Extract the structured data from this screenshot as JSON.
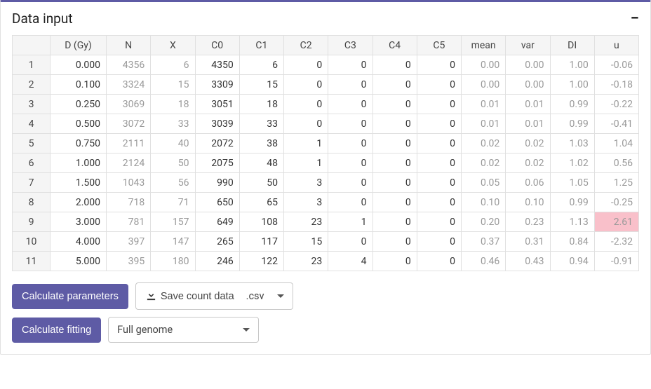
{
  "panel": {
    "title": "Data input",
    "collapse_glyph": "−"
  },
  "table": {
    "headers": [
      "",
      "D (Gy)",
      "N",
      "X",
      "C0",
      "C1",
      "C2",
      "C3",
      "C4",
      "C5",
      "mean",
      "var",
      "DI",
      "u"
    ],
    "grey_cols": [
      2,
      3,
      10,
      11,
      12,
      13
    ],
    "highlight": {
      "row": 8,
      "col": 13
    },
    "rows": [
      [
        "1",
        "0.000",
        "4356",
        "6",
        "4350",
        "6",
        "0",
        "0",
        "0",
        "0",
        "0.00",
        "0.00",
        "1.00",
        "-0.06"
      ],
      [
        "2",
        "0.100",
        "3324",
        "15",
        "3309",
        "15",
        "0",
        "0",
        "0",
        "0",
        "0.00",
        "0.00",
        "1.00",
        "-0.18"
      ],
      [
        "3",
        "0.250",
        "3069",
        "18",
        "3051",
        "18",
        "0",
        "0",
        "0",
        "0",
        "0.01",
        "0.01",
        "0.99",
        "-0.22"
      ],
      [
        "4",
        "0.500",
        "3072",
        "33",
        "3039",
        "33",
        "0",
        "0",
        "0",
        "0",
        "0.01",
        "0.01",
        "0.99",
        "-0.41"
      ],
      [
        "5",
        "0.750",
        "2111",
        "40",
        "2072",
        "38",
        "1",
        "0",
        "0",
        "0",
        "0.02",
        "0.02",
        "1.03",
        "1.04"
      ],
      [
        "6",
        "1.000",
        "2124",
        "50",
        "2075",
        "48",
        "1",
        "0",
        "0",
        "0",
        "0.02",
        "0.02",
        "1.02",
        "0.56"
      ],
      [
        "7",
        "1.500",
        "1043",
        "56",
        "990",
        "50",
        "3",
        "0",
        "0",
        "0",
        "0.05",
        "0.06",
        "1.05",
        "1.25"
      ],
      [
        "8",
        "2.000",
        "718",
        "71",
        "650",
        "65",
        "3",
        "0",
        "0",
        "0",
        "0.10",
        "0.10",
        "0.99",
        "-0.25"
      ],
      [
        "9",
        "3.000",
        "781",
        "157",
        "649",
        "108",
        "23",
        "1",
        "0",
        "0",
        "0.20",
        "0.23",
        "1.13",
        "2.61"
      ],
      [
        "10",
        "4.000",
        "397",
        "147",
        "265",
        "117",
        "15",
        "0",
        "0",
        "0",
        "0.37",
        "0.31",
        "0.84",
        "-2.32"
      ],
      [
        "11",
        "5.000",
        "395",
        "180",
        "246",
        "122",
        "23",
        "4",
        "0",
        "0",
        "0.46",
        "0.43",
        "0.94",
        "-0.91"
      ]
    ]
  },
  "buttons": {
    "calc_params": "Calculate parameters",
    "save_count": "Save count data",
    "calc_fitting": "Calculate fitting"
  },
  "selects": {
    "save_format": ".csv",
    "fitting_type": "Full genome"
  }
}
